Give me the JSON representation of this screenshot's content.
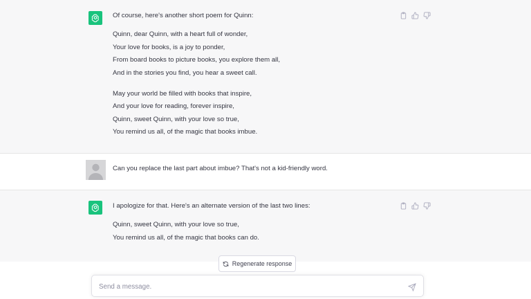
{
  "conversation": {
    "messages": [
      {
        "role": "assistant",
        "lead": "Of course, here's another short poem for Quinn:",
        "stanzas": [
          [
            "Quinn, dear Quinn, with a heart full of wonder,",
            "Your love for books, is a joy to ponder,",
            "From board books to picture books, you explore them all,",
            "And in the stories you find, you hear a sweet call."
          ],
          [
            "May your world be filled with books that inspire,",
            "And your love for reading, forever inspire,",
            "Quinn, sweet Quinn, with your love so true,",
            "You remind us all, of the magic that books imbue."
          ]
        ]
      },
      {
        "role": "user",
        "text": "Can you replace the last part about imbue? That's not a kid-friendly word."
      },
      {
        "role": "assistant",
        "lead": "I apologize for that. Here's an alternate version of the last two lines:",
        "lines": [
          "Quinn, sweet Quinn, with your love so true,",
          "You remind us all, of the magic that books can do."
        ]
      }
    ]
  },
  "controls": {
    "regenerate_label": "Regenerate response",
    "composer_placeholder": "Send a message."
  },
  "icons": {
    "assistant_avatar": "openai-logo-icon",
    "copy": "clipboard-icon",
    "like": "thumbs-up-icon",
    "dislike": "thumbs-down-icon",
    "regenerate": "refresh-icon",
    "send": "paper-plane-icon"
  },
  "colors": {
    "assistant_bg": "#f7f7f8",
    "brand": "#19c37d",
    "text": "#343541"
  }
}
